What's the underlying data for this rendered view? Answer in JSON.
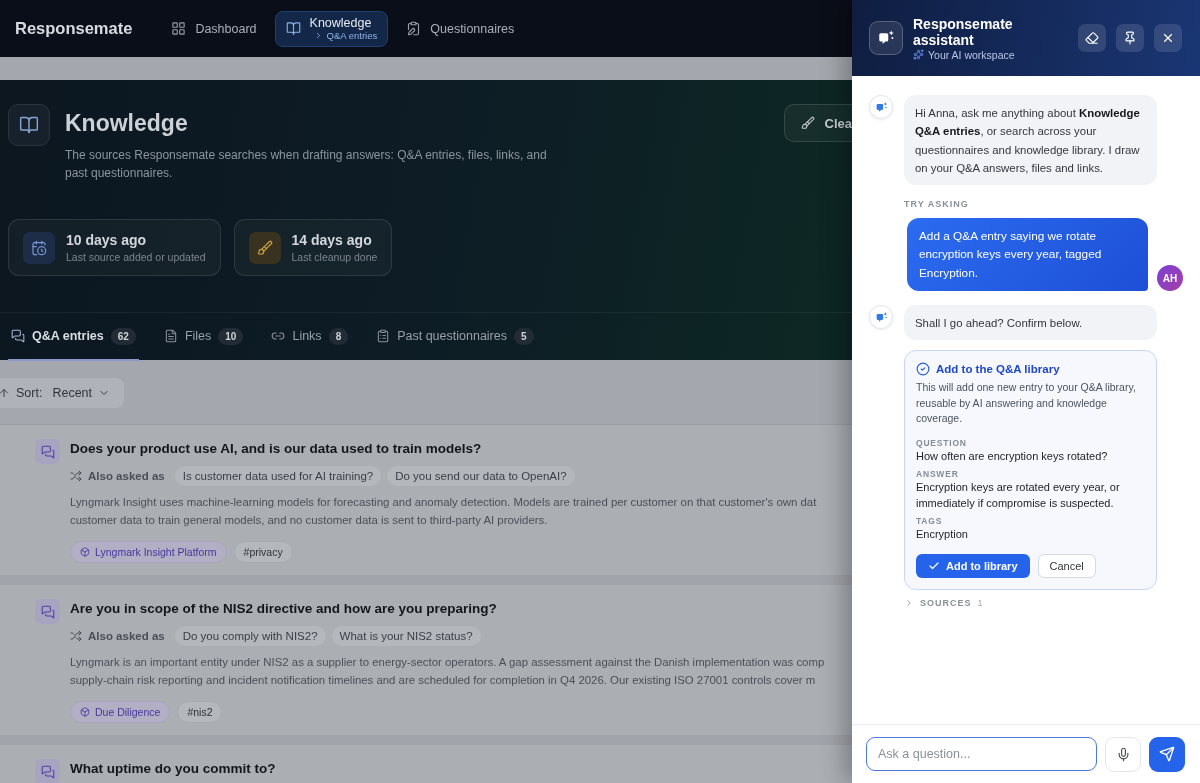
{
  "header": {
    "brand": "Responsemate",
    "nav": [
      {
        "label": "Dashboard",
        "selected": false
      },
      {
        "label": "Knowledge",
        "sublabel": "Q&A entries",
        "selected": true
      },
      {
        "label": "Questionnaires",
        "selected": false
      }
    ]
  },
  "page": {
    "title": "Knowledge",
    "description": "The sources Responsemate searches when drafting answers: Q&A entries, files, links, and past questionnaires.",
    "action_button": "Clea",
    "stats": [
      {
        "value": "10 days ago",
        "label": "Last source added or updated"
      },
      {
        "value": "14 days ago",
        "label": "Last cleanup done"
      }
    ]
  },
  "tabs": [
    {
      "label": "Q&A entries",
      "count": "62",
      "selected": true
    },
    {
      "label": "Files",
      "count": "10",
      "selected": false
    },
    {
      "label": "Links",
      "count": "8",
      "selected": false
    },
    {
      "label": "Past questionnaires",
      "count": "5",
      "selected": false
    }
  ],
  "sort": {
    "label": "Sort:",
    "value": "Recent"
  },
  "entries": [
    {
      "question": "Does your product use AI, and is our data used to train models?",
      "also_asked_label": "Also asked as",
      "also_asked": [
        "Is customer data used for AI training?",
        "Do you send our data to OpenAI?"
      ],
      "answer_lines": [
        "Lyngmark Insight uses machine-learning models for forecasting and anomaly detection. Models are trained per customer on that customer's own dat",
        "customer data to train general models, and no customer data is sent to third-party AI providers."
      ],
      "tags": [
        {
          "label": "Lyngmark Insight Platform",
          "kind": "product"
        },
        {
          "label": "#privacy",
          "kind": "hashtag"
        }
      ]
    },
    {
      "question": "Are you in scope of the NIS2 directive and how are you preparing?",
      "also_asked_label": "Also asked as",
      "also_asked": [
        "Do you comply with NIS2?",
        "What is your NIS2 status?"
      ],
      "answer_lines": [
        "Lyngmark is an important entity under NIS2 as a supplier to energy-sector operators. A gap assessment against the Danish implementation was comp",
        "supply-chain risk reporting and incident notification timelines and are scheduled for completion in Q4 2026. Our existing ISO 27001 controls cover m"
      ],
      "tags": [
        {
          "label": "Due Diligence",
          "kind": "product"
        },
        {
          "label": "#nis2",
          "kind": "hashtag"
        }
      ]
    },
    {
      "question": "What uptime do you commit to?"
    }
  ],
  "assistant": {
    "title": "Responsemate assistant",
    "subtitle": "Your AI workspace",
    "messages": [
      {
        "kind": "bot",
        "text": "Hi Anna, ask me anything about **Knowledge Q&A entries**, or search across your questionnaires and knowledge library. I draw on your Q&A answers, files and links."
      },
      {
        "kind": "label",
        "text": "TRY ASKING"
      },
      {
        "kind": "user",
        "text": "Add a Q&A entry saying we rotate encryption keys every year, tagged Encryption.",
        "avatar": "AH"
      },
      {
        "kind": "bot",
        "text": "Shall I go ahead? Confirm below."
      },
      {
        "kind": "confirm",
        "title": "Add to the Q&A library",
        "description": "This will add one new entry to your Q&A library, reusable by AI answering and knowledge coverage.",
        "fields": [
          {
            "label": "QUESTION",
            "value": "How often are encryption keys rotated?"
          },
          {
            "label": "ANSWER",
            "value": "Encryption keys are rotated every year, or immediately if compromise is suspected."
          },
          {
            "label": "TAGS",
            "value": "Encryption"
          }
        ],
        "confirm_button": "Add to library",
        "cancel_button": "Cancel"
      },
      {
        "kind": "sources",
        "label": "SOURCES",
        "count": "1",
        "expanded": false
      }
    ],
    "input": {
      "placeholder": "Ask a question..."
    }
  }
}
